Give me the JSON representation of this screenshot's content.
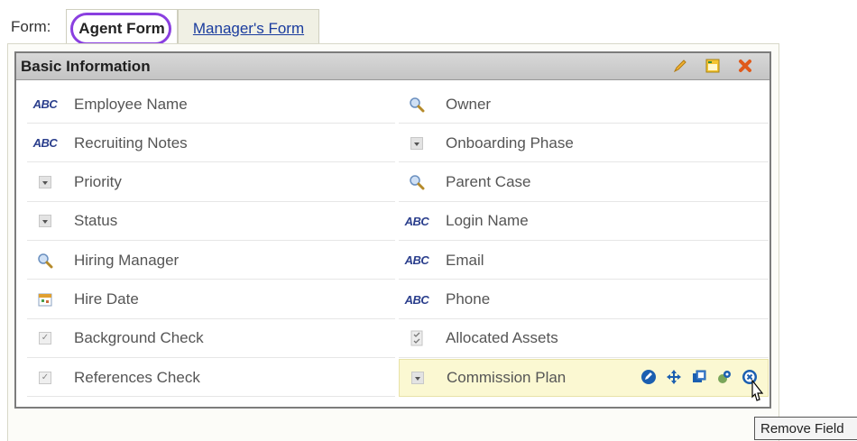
{
  "form": {
    "label": "Form:",
    "tabs": [
      {
        "label": "Agent Form",
        "active": true
      },
      {
        "label": "Manager's Form",
        "active": false
      }
    ]
  },
  "panel": {
    "title": "Basic Information",
    "header_icons": [
      "edit-icon",
      "layout-icon",
      "close-icon"
    ]
  },
  "fields_left": [
    {
      "label": "Employee Name",
      "icon": "text-field-icon"
    },
    {
      "label": "Recruiting Notes",
      "icon": "text-field-icon"
    },
    {
      "label": "Priority",
      "icon": "dropdown-icon"
    },
    {
      "label": "Status",
      "icon": "dropdown-icon"
    },
    {
      "label": "Hiring Manager",
      "icon": "lookup-icon"
    },
    {
      "label": "Hire Date",
      "icon": "date-icon"
    },
    {
      "label": "Background Check",
      "icon": "checkbox-icon"
    },
    {
      "label": "References Check",
      "icon": "checkbox-icon"
    }
  ],
  "fields_right": [
    {
      "label": "Owner",
      "icon": "lookup-icon"
    },
    {
      "label": "Onboarding Phase",
      "icon": "dropdown-icon"
    },
    {
      "label": "Parent Case",
      "icon": "lookup-icon"
    },
    {
      "label": "Login Name",
      "icon": "text-field-icon"
    },
    {
      "label": "Email",
      "icon": "text-field-icon"
    },
    {
      "label": "Phone",
      "icon": "text-field-icon"
    },
    {
      "label": "Allocated Assets",
      "icon": "multiselect-icon"
    },
    {
      "label": "Commission Plan",
      "icon": "dropdown-icon",
      "highlighted": true
    }
  ],
  "field_actions": [
    "edit-field-icon",
    "move-icon",
    "copy-icon",
    "settings-icon",
    "remove-icon"
  ],
  "abc_text": "ABC",
  "tooltip": "Remove Field",
  "colors": {
    "tab_ring": "#8a3fe0",
    "highlight": "#fbf8d2",
    "header": "#c9c9c9"
  }
}
